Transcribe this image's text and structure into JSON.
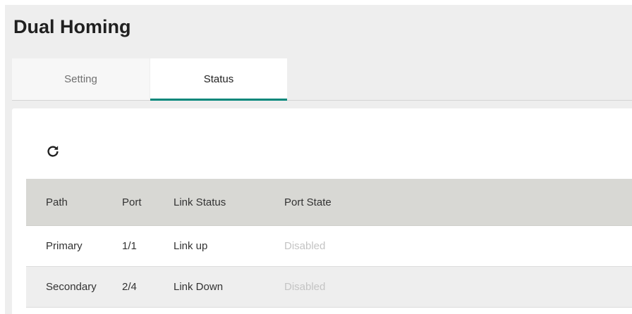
{
  "page": {
    "title": "Dual Homing"
  },
  "tabs": [
    {
      "label": "Setting",
      "active": false
    },
    {
      "label": "Status",
      "active": true
    }
  ],
  "toolbar": {
    "refresh_icon": "refresh-icon"
  },
  "table": {
    "columns": [
      "Path",
      "Port",
      "Link Status",
      "Port State"
    ],
    "rows": [
      {
        "path": "Primary",
        "port": "1/1",
        "link_status": "Link up",
        "port_state": "Disabled"
      },
      {
        "path": "Secondary",
        "port": "2/4",
        "link_status": "Link Down",
        "port_state": "Disabled"
      }
    ]
  },
  "colors": {
    "accent": "#00867a",
    "header_bg": "#d8d8d4",
    "disabled_text": "#c4c4c4"
  }
}
